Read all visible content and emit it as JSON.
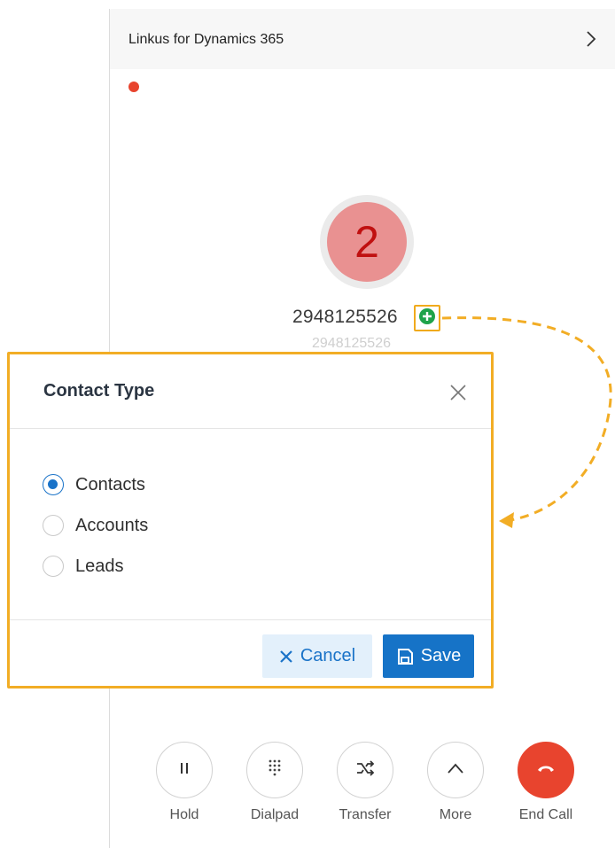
{
  "header": {
    "title": "Linkus for Dynamics 365",
    "chevron_icon": "chevron-right-icon"
  },
  "call": {
    "avatar_initial": "2",
    "number": "2948125526",
    "sub_number": "2948125526",
    "add_icon": "plus-circle-icon",
    "recording_color": "#e8442e"
  },
  "dialog": {
    "title": "Contact Type",
    "options": [
      {
        "label": "Contacts",
        "checked": true
      },
      {
        "label": "Accounts",
        "checked": false
      },
      {
        "label": "Leads",
        "checked": false
      }
    ],
    "cancel_label": "Cancel",
    "save_label": "Save",
    "highlight_color": "#f2ad25"
  },
  "controls": [
    {
      "label": "Hold",
      "icon": "pause-icon"
    },
    {
      "label": "Dialpad",
      "icon": "dialpad-icon"
    },
    {
      "label": "Transfer",
      "icon": "transfer-icon"
    },
    {
      "label": "More",
      "icon": "chevron-up-icon"
    },
    {
      "label": "End Call",
      "icon": "hangup-icon"
    }
  ],
  "colors": {
    "accent": "#1673c7",
    "end_call": "#e8442e",
    "add_green": "#1fa34a"
  }
}
